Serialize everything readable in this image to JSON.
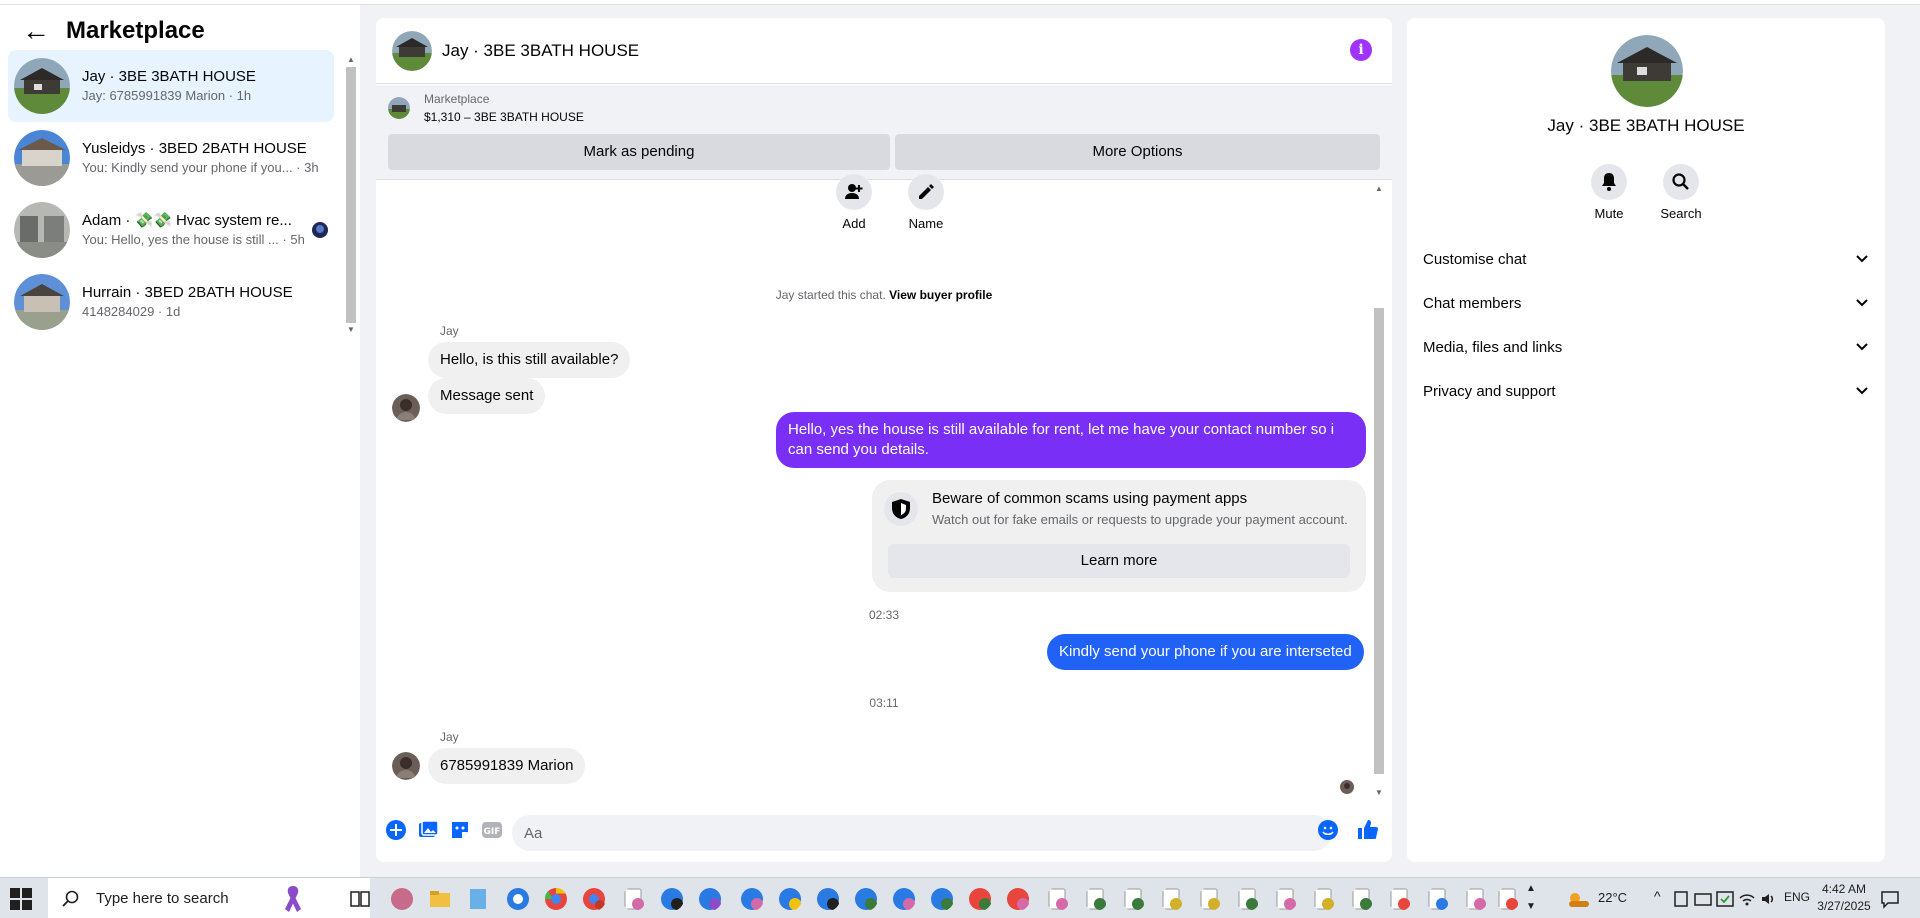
{
  "left_panel": {
    "title": "Marketplace",
    "conversations": [
      {
        "title": "Jay · 3BE 3BATH HOUSE",
        "snippet": "Jay: 6785991839 Marion · 1h",
        "active": true
      },
      {
        "title": "Yusleidys · 3BED 2BATH HOUSE",
        "snippet": "You: Kindly send your phone if you... · 3h",
        "active": false
      },
      {
        "title": "Adam · 💸💸 Hvac system re...",
        "snippet": "You: Hello, yes the house is still ... · 5h",
        "active": false
      },
      {
        "title": "Hurrain · 3BED 2BATH HOUSE",
        "snippet": "4148284029 · 1d",
        "active": false
      }
    ]
  },
  "chat": {
    "header_name": "Jay · 3BE 3BATH HOUSE",
    "listing": {
      "label": "Marketplace",
      "price_title": "$1,310 – 3BE 3BATH HOUSE",
      "pending_button": "Mark as pending",
      "more_button": "More Options"
    },
    "actions": {
      "add": "Add",
      "name": "Name"
    },
    "started": "Jay started this chat.",
    "view_profile": "View buyer profile",
    "sender_1": "Jay",
    "msg_in_1": "Hello, is this still available?",
    "msg_in_2": "Message sent",
    "msg_out_1": "Hello, yes the house is still available for rent, let me have your contact number so i can send you details.",
    "warning": {
      "title": "Beware of common scams using payment apps",
      "desc": "Watch out for fake emails or requests to upgrade your payment account.",
      "button": "Learn more"
    },
    "time_1": "02:33",
    "msg_out_2": "Kindly send your phone if you are interseted",
    "time_2": "03:11",
    "sender_2": "Jay",
    "msg_in_3": "6785991839 Marion",
    "composer_placeholder": "Aa"
  },
  "right_panel": {
    "name": "Jay · 3BE 3BATH HOUSE",
    "mute": "Mute",
    "search": "Search",
    "sections": [
      "Customise chat",
      "Chat members",
      "Media, files and links",
      "Privacy and support"
    ]
  },
  "taskbar": {
    "search_placeholder": "Type here to search",
    "weather": "22°C",
    "lang": "ENG",
    "time": "4:42 AM",
    "date": "3/27/2025"
  },
  "colors": {
    "accent_blue": "#0866ff",
    "accent_purple": "#a033ff",
    "out_bubble_1": "#7a2ff7",
    "out_bubble_2": "#1f62f5"
  }
}
